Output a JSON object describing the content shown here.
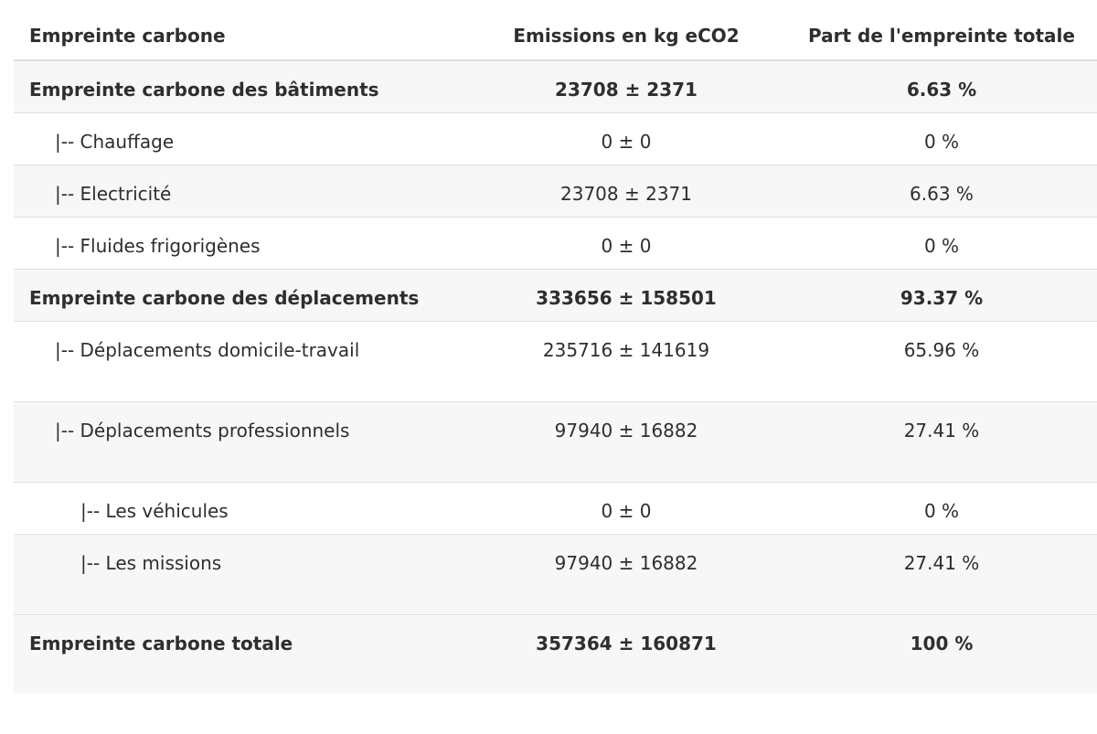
{
  "table": {
    "headers": [
      "Empreinte carbone",
      "Emissions en kg eCO2",
      "Part de l'empreinte totale"
    ],
    "rows": [
      {
        "label": "Empreinte carbone des bâtiments",
        "emissions": "23708 ± 2371",
        "share": "6.63 %"
      },
      {
        "label": "|-- Chauffage",
        "emissions": "0 ± 0",
        "share": "0 %"
      },
      {
        "label": "|-- Electricité",
        "emissions": "23708 ± 2371",
        "share": "6.63 %"
      },
      {
        "label": "|-- Fluides frigorigènes",
        "emissions": "0 ± 0",
        "share": "0 %"
      },
      {
        "label": "Empreinte carbone des déplacements",
        "emissions": "333656 ± 158501",
        "share": "93.37 %"
      },
      {
        "label": "|-- Déplacements domicile-travail",
        "emissions": "235716 ± 141619",
        "share": "65.96 %"
      },
      {
        "label": "|-- Déplacements professionnels",
        "emissions": "97940 ± 16882",
        "share": "27.41 %"
      },
      {
        "label": "|-- Les véhicules",
        "emissions": "0 ± 0",
        "share": "0 %"
      },
      {
        "label": "|-- Les missions",
        "emissions": "97940 ± 16882",
        "share": "27.41 %"
      },
      {
        "label": "Empreinte carbone totale",
        "emissions": "357364 ± 160871",
        "share": "100 %"
      }
    ]
  }
}
